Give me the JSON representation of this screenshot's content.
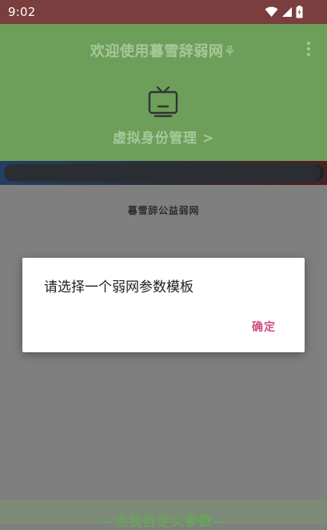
{
  "status_bar": {
    "time": "9:02"
  },
  "header": {
    "title": "欢迎使用暮雪辞弱网⚘",
    "identity_link": "虚拟身份管理 >"
  },
  "progress": {
    "value": 0.99
  },
  "main": {
    "subtitle": "暮雪辞公益弱网"
  },
  "dialog": {
    "message": "请选择一个弱网参数模板",
    "confirm_label": "确定"
  },
  "bottom": {
    "custom_label": "—点我自定义参数—"
  },
  "colors": {
    "accent": "#d24a86",
    "header_green": "#6d9f5a",
    "status_bar": "#7a3e3e"
  }
}
